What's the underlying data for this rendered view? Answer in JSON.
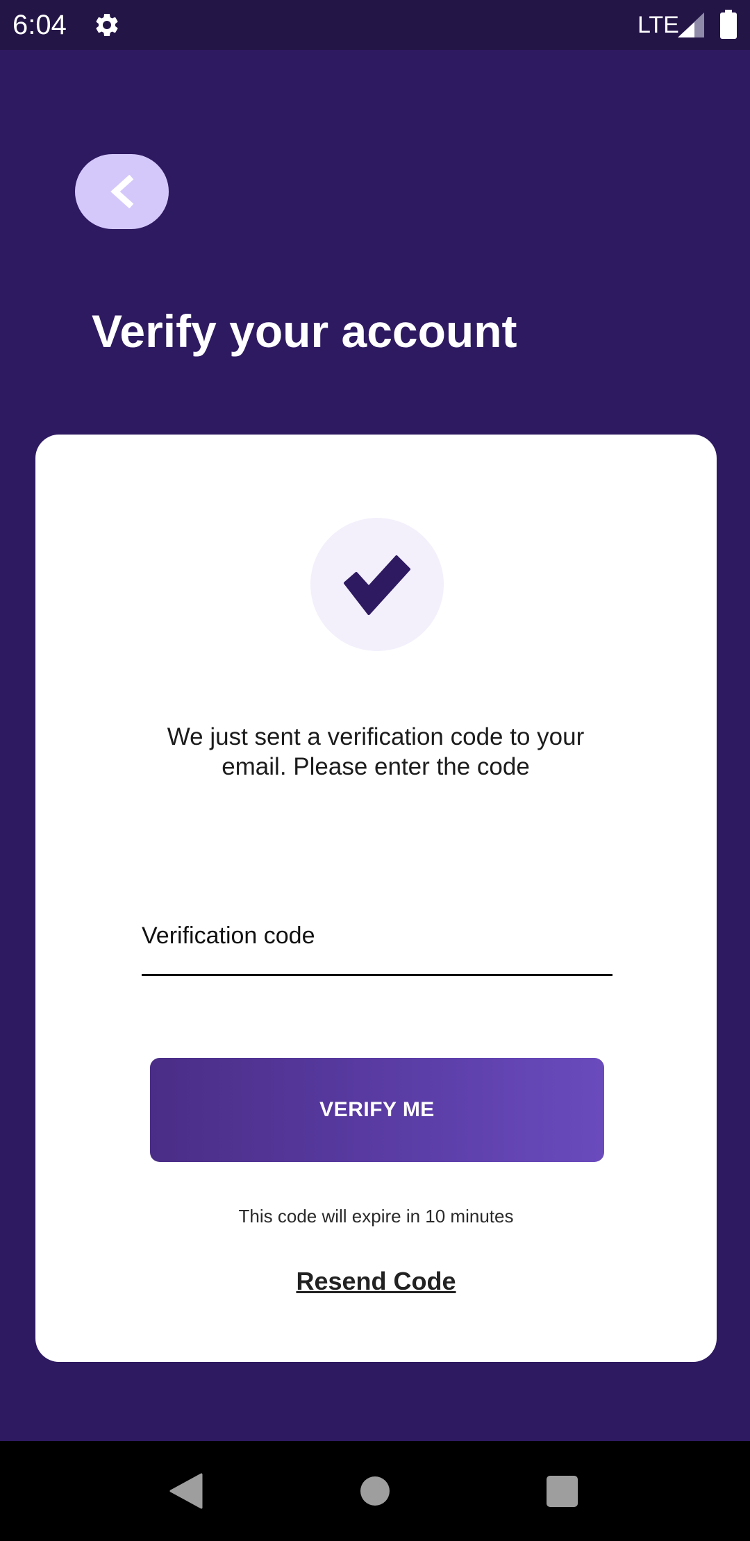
{
  "status_bar": {
    "time": "6:04",
    "network": "LTE",
    "icons": [
      "gear-icon",
      "signal-icon",
      "battery-icon"
    ]
  },
  "header": {
    "back_icon": "chevron-left-icon",
    "title": "Verify your account"
  },
  "card": {
    "badge_icon": "checkmark-icon",
    "message": "We just sent a verification code to your email. Please enter the code",
    "code_input": {
      "placeholder": "Verification code",
      "value": ""
    },
    "verify_button_label": "VERIFY ME",
    "expire_note": "This code will expire in 10 minutes",
    "resend_label": "Resend Code"
  },
  "nav_bar": {
    "icons": [
      "nav-back-icon",
      "nav-home-icon",
      "nav-recents-icon"
    ]
  },
  "colors": {
    "background": "#2e1a61",
    "status_bar": "#241547",
    "back_button": "#d4c8fb",
    "check_circle": "#f3f0fc",
    "check_mark": "#2e1a61",
    "button_gradient_start": "#4a2d86",
    "button_gradient_end": "#6a4bbd"
  }
}
